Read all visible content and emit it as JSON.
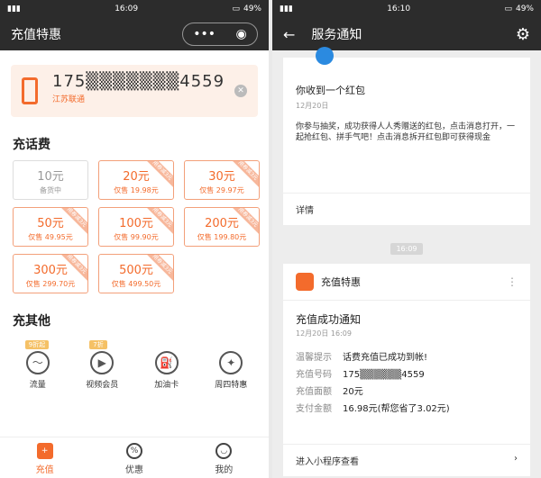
{
  "left": {
    "status": {
      "time": "16:09",
      "battery": "49%"
    },
    "nav": {
      "title": "充值特惠",
      "more": "•••",
      "target": "◉"
    },
    "phone": {
      "number": "175▒▒▒▒▒▒▒4559",
      "carrier": "江苏联通",
      "clear": "✕"
    },
    "section_recharge": "充话费",
    "tiles": [
      {
        "amount": "10元",
        "sub": "备货中",
        "ribbon": "",
        "disabled": true
      },
      {
        "amount": "20元",
        "sub": "仅售 19.98元",
        "ribbon": "用券减3元",
        "disabled": false
      },
      {
        "amount": "30元",
        "sub": "仅售 29.97元",
        "ribbon": "用券减3元",
        "disabled": false
      },
      {
        "amount": "50元",
        "sub": "仅售 49.95元",
        "ribbon": "用券减3元",
        "disabled": false
      },
      {
        "amount": "100元",
        "sub": "仅售 99.90元",
        "ribbon": "用券减3元",
        "disabled": false
      },
      {
        "amount": "200元",
        "sub": "仅售 199.80元",
        "ribbon": "用券减3元",
        "disabled": false
      },
      {
        "amount": "300元",
        "sub": "仅售 299.70元",
        "ribbon": "用券减3元",
        "disabled": false
      },
      {
        "amount": "500元",
        "sub": "仅售 499.50元",
        "ribbon": "用券减3元",
        "disabled": false
      }
    ],
    "section_other": "充其他",
    "others": [
      {
        "label": "流量",
        "icon": "flow-icon",
        "glyph": "〜",
        "badge": "9折起"
      },
      {
        "label": "视频会员",
        "icon": "video-icon",
        "glyph": "▶",
        "badge": "7折"
      },
      {
        "label": "加油卡",
        "icon": "fuel-icon",
        "glyph": "⛽",
        "badge": ""
      },
      {
        "label": "周四特惠",
        "icon": "tag-icon",
        "glyph": "✦",
        "badge": ""
      }
    ],
    "tabs": [
      {
        "label": "充值",
        "glyph": "+",
        "active": true
      },
      {
        "label": "优惠",
        "glyph": "%",
        "active": false
      },
      {
        "label": "我的",
        "glyph": "◡",
        "active": false
      }
    ]
  },
  "right": {
    "status": {
      "time": "16:10",
      "battery": "49%"
    },
    "nav": {
      "back": "←",
      "title": "服务通知",
      "settings": "⚙"
    },
    "msg1": {
      "title": "你收到一个红包",
      "date": "12月20日",
      "body": "你参与抽奖，成功获得人人秀赠送的红包，点击消息打开，一起抢红包、拼手气吧！点击消息拆开红包即可获得现金",
      "detail": "详情"
    },
    "time_pill": "16:09",
    "msg2": {
      "sender": "充值特惠",
      "dots": "⋮",
      "title": "充值成功通知",
      "date": "12月20日 16:09",
      "rows": [
        {
          "k": "温馨提示",
          "v": "话费充值已成功到帐!"
        },
        {
          "k": "充值号码",
          "v": "175▒▒▒▒▒▒4559"
        },
        {
          "k": "充值面额",
          "v": "20元"
        },
        {
          "k": "支付金额",
          "v": "16.98元(帮您省了3.02元)"
        }
      ],
      "footer": "进入小程序查看",
      "chevron": "›"
    }
  }
}
